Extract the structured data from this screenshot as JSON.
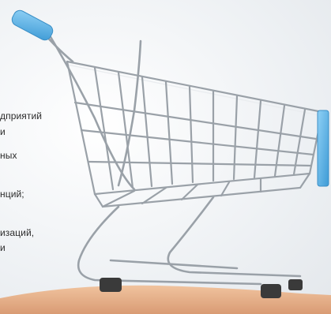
{
  "text_fragments": [
    "дприятий",
    "и",
    "ных",
    "нций;",
    "изаций,",
    "и"
  ],
  "colors": {
    "handle_blue": "#5fb3e6",
    "wire_metal": "#9aa1a8",
    "wire_highlight": "#e9ecef",
    "hand_skin": "#e8b58e",
    "wheel_dark": "#3a3a3a"
  }
}
